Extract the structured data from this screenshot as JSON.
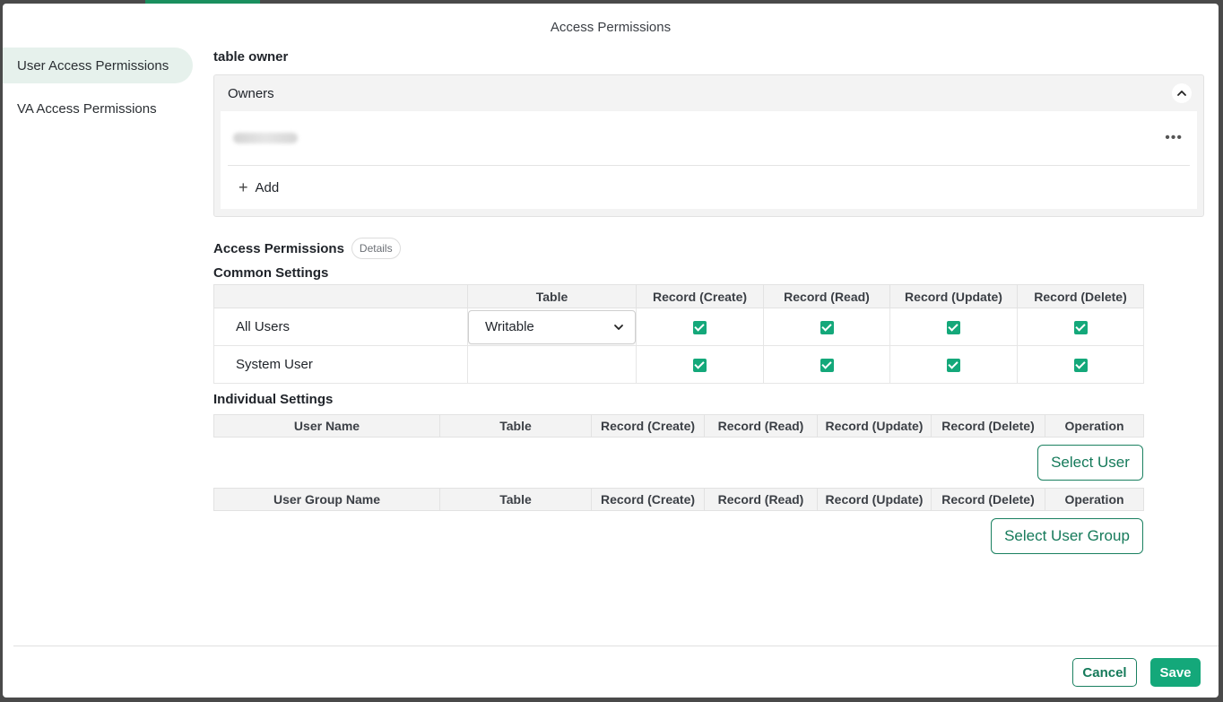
{
  "modal": {
    "title": "Access Permissions"
  },
  "sidebar": {
    "items": [
      {
        "label": "User Access Permissions",
        "active": true
      },
      {
        "label": "VA Access Permissions",
        "active": false
      }
    ]
  },
  "owner_section": {
    "heading": "table owner",
    "panel_title": "Owners",
    "add_label": "Add",
    "more_label": "•••"
  },
  "access": {
    "heading": "Access Permissions",
    "details_label": "Details",
    "common_heading": "Common Settings",
    "common_columns": [
      "",
      "Table",
      "Record (Create)",
      "Record (Read)",
      "Record (Update)",
      "Record (Delete)"
    ],
    "rows": [
      {
        "user": "All Users",
        "table_value": "Writable",
        "create": true,
        "read": true,
        "update": true,
        "delete": true
      },
      {
        "user": "System User",
        "table_value": "",
        "create": true,
        "read": true,
        "update": true,
        "delete": true
      }
    ],
    "individual_heading": "Individual Settings",
    "user_columns": [
      "User Name",
      "Table",
      "Record (Create)",
      "Record (Read)",
      "Record (Update)",
      "Record (Delete)",
      "Operation"
    ],
    "select_user_label": "Select User",
    "group_columns": [
      "User Group Name",
      "Table",
      "Record (Create)",
      "Record (Read)",
      "Record (Update)",
      "Record (Delete)",
      "Operation"
    ],
    "select_group_label": "Select User Group"
  },
  "footer": {
    "cancel_label": "Cancel",
    "save_label": "Save"
  },
  "colors": {
    "accent": "#14a87a",
    "accent_dark": "#157a5a",
    "active_bg": "#e6f1ec"
  }
}
